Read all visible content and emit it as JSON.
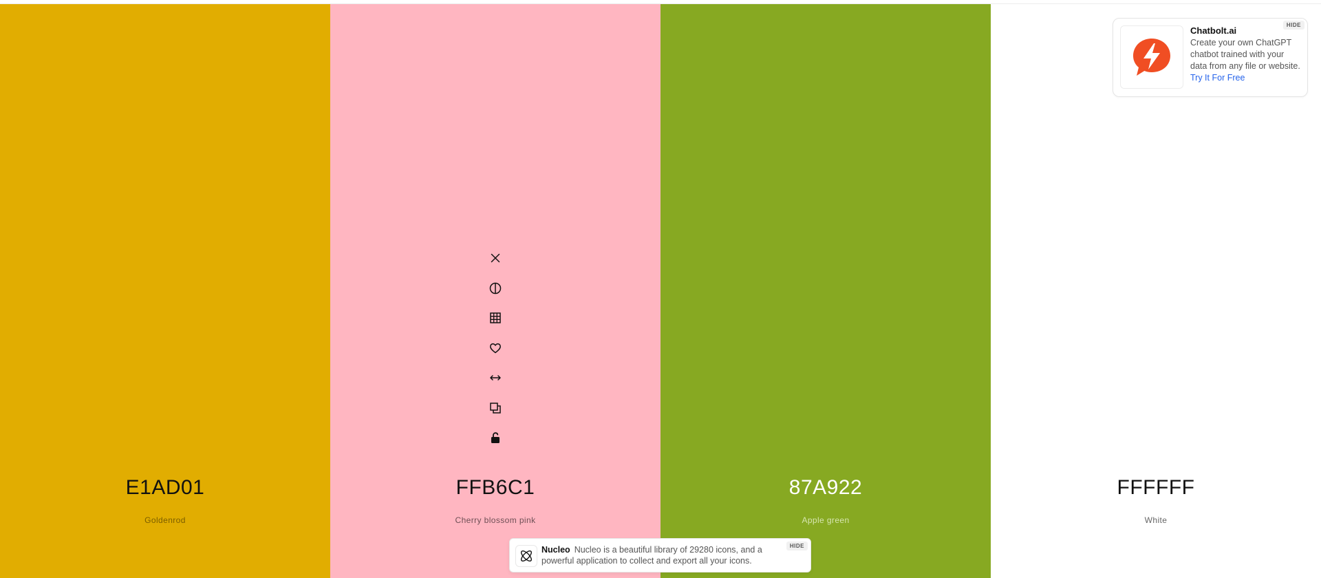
{
  "palette": [
    {
      "hex": "E1AD01",
      "name": "Goldenrod",
      "bg": "#E1AD01",
      "hex_color": "#111111",
      "name_color": "#7a5d00"
    },
    {
      "hex": "FFB6C1",
      "name": "Cherry blossom pink",
      "bg": "#FFB6C1",
      "hex_color": "#111111",
      "name_color": "#6e4f55"
    },
    {
      "hex": "87A922",
      "name": "Apple green",
      "bg": "#87A922",
      "hex_color": "#ffffff",
      "name_color": "#d7e6b0"
    },
    {
      "hex": "FFFFFF",
      "name": "White",
      "bg": "#FFFFFF",
      "hex_color": "#111111",
      "name_color": "#666666"
    }
  ],
  "toolbar_icons": [
    "close-icon",
    "contrast-icon",
    "grid-icon",
    "heart-icon",
    "arrows-horizontal-icon",
    "copy-icon",
    "unlock-icon"
  ],
  "ad": {
    "title": "Chatbolt.ai",
    "text": "Create your own ChatGPT chatbot trained with your data from any file or website.",
    "link": "Try It For Free",
    "hide": "HIDE",
    "brand_color": "#F04E23"
  },
  "banner": {
    "title": "Nucleo",
    "text": "Nucleo is a beautiful library of 29280 icons, and a powerful application to collect and export all your icons.",
    "hide": "HIDE"
  }
}
